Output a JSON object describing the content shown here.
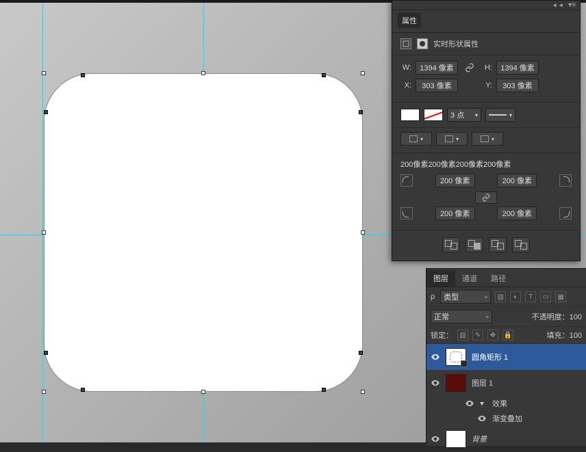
{
  "panel": {
    "title": "属性",
    "live_shape_label": "实时形状属性",
    "w_label": "W:",
    "h_label": "H:",
    "x_label": "X:",
    "y_label": "Y:",
    "w_val": "1394 像素",
    "h_val": "1394 像素",
    "x_val": "303 像素",
    "y_val": "303 像素",
    "stroke_points": "3 点",
    "radius_summary": "200像素200像素200像素200像素",
    "r_tl": "200 像素",
    "r_tr": "200 像素",
    "r_bl": "200 像素",
    "r_br": "200 像素"
  },
  "layers": {
    "tabs": {
      "t0": "图层",
      "t1": "通道",
      "t2": "路径"
    },
    "filter_kind": "类型",
    "blend_mode": "正常",
    "opacity_label": "不透明度：",
    "opacity_val": "100",
    "lock_label": "锁定：",
    "fill_label": "填充：",
    "fill_val": "100",
    "items": [
      {
        "name": "圆角矩形 1",
        "kind": "shape"
      },
      {
        "name": "图层 1",
        "kind": "raster"
      },
      {
        "name": "背景",
        "kind": "bg"
      }
    ],
    "fx_label": "效果",
    "fx_item": "渐变叠加"
  }
}
